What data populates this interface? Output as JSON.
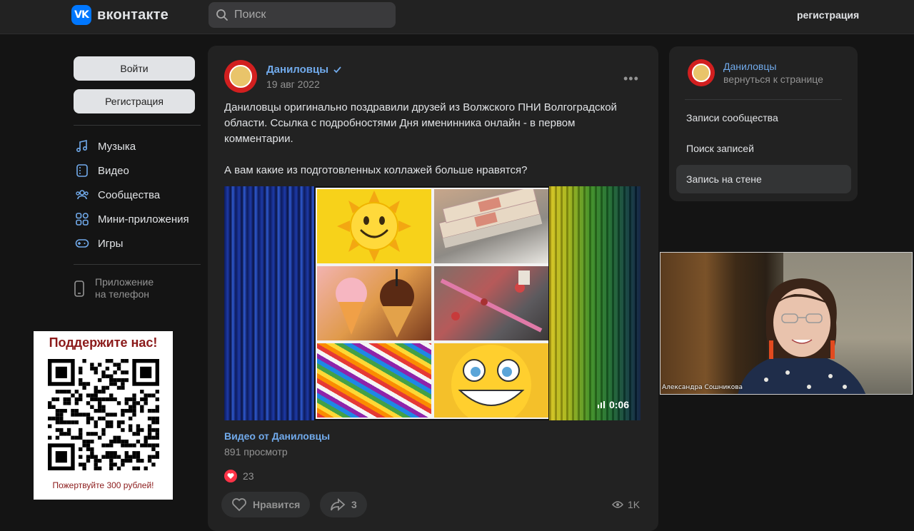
{
  "header": {
    "logo_text": "вконтакте",
    "logo_mark": "VK",
    "search_placeholder": "Поиск",
    "register_link": "регистрация"
  },
  "left": {
    "login_button": "Войти",
    "register_button": "Регистрация",
    "nav": [
      {
        "label": "Музыка",
        "icon": "music-icon"
      },
      {
        "label": "Видео",
        "icon": "video-icon"
      },
      {
        "label": "Сообщества",
        "icon": "communities-icon"
      },
      {
        "label": "Мини-приложения",
        "icon": "apps-icon"
      },
      {
        "label": "Игры",
        "icon": "gamepad-icon"
      }
    ],
    "phone_app_line1": "Приложение",
    "phone_app_line2": "на телефон"
  },
  "support": {
    "title": "Поддержите нас!",
    "note": "Пожертвуйте 300 рублей!"
  },
  "post": {
    "author": "Даниловцы",
    "date": "19 авг 2022",
    "text_p1": "Даниловцы оригинально поздравили друзей из Волжского ПНИ Волгоградской области. Ссылка с подробностями Дня именинника онлайн - в первом комментарии.",
    "text_p2": "А вам какие из подготовленных коллажей больше нравятся?",
    "video_duration": "0:06",
    "video_title": "Видео от Даниловцы",
    "video_views": "891 просмотр",
    "likes_count": "23",
    "like_button": "Нравится",
    "share_count": "3",
    "views_count": "1K"
  },
  "right": {
    "community_name": "Даниловцы",
    "back_link": "вернуться к странице",
    "items": [
      "Записи сообщества",
      "Поиск записей",
      "Запись на стене"
    ]
  },
  "webcam": {
    "participant_name": "Александра Сошникова"
  },
  "colors": {
    "background": "#141414",
    "panel": "#222222",
    "link": "#71aaeb",
    "vk_blue": "#0077ff",
    "like_red": "#ff3347"
  }
}
